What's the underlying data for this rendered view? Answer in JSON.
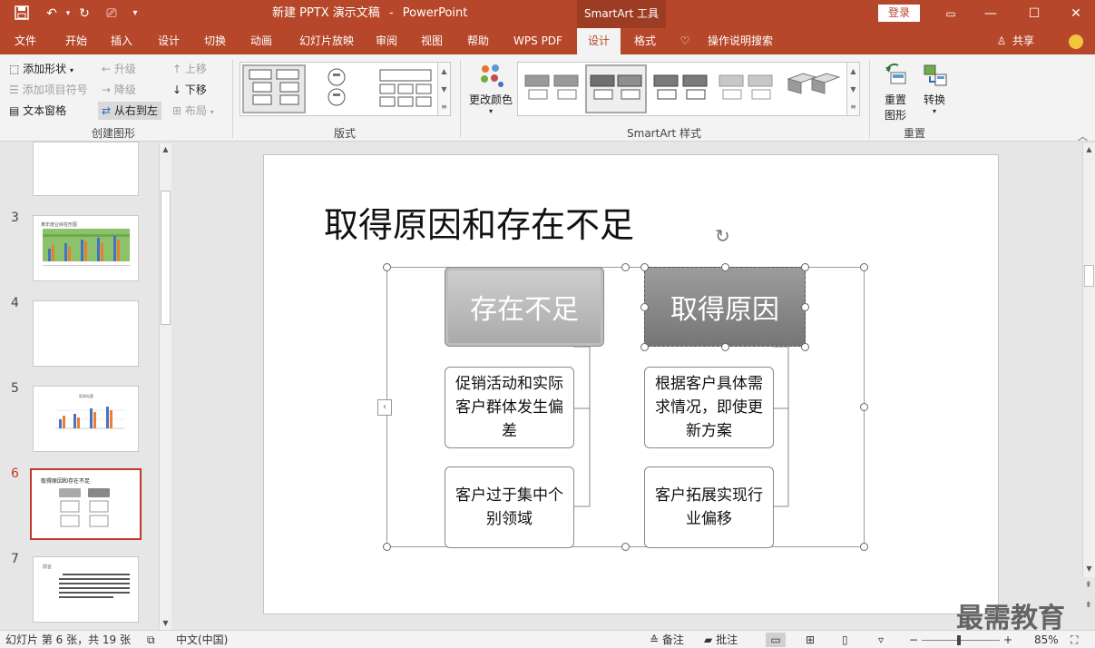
{
  "window": {
    "doc_title": "新建 PPTX 演示文稿",
    "separator": "-",
    "app_name": "PowerPoint",
    "context_tab": "SmartArt 工具",
    "login": "登录"
  },
  "tabs": [
    "文件",
    "开始",
    "插入",
    "设计",
    "切换",
    "动画",
    "幻灯片放映",
    "审阅",
    "视图",
    "帮助",
    "WPS PDF",
    "设计",
    "格式"
  ],
  "tell_me": "操作说明搜索",
  "share": "共享",
  "ribbon": {
    "create": {
      "add_shape": "添加形状",
      "add_bullet": "添加项目符号",
      "text_pane": "文本窗格",
      "promote": "升级",
      "demote": "降级",
      "rtl": "从右到左",
      "move_up": "上移",
      "move_down": "下移",
      "layout": "布局",
      "label": "创建图形"
    },
    "layouts_label": "版式",
    "change_colors": "更改颜色",
    "styles_label": "SmartArt 样式",
    "reset": {
      "reset_graphic_1": "重置",
      "reset_graphic_2": "图形",
      "convert": "转换",
      "label": "重置"
    }
  },
  "thumbnails": [
    {
      "num": "3",
      "caption": "某年度业绩柱形图"
    },
    {
      "num": "4",
      "caption": ""
    },
    {
      "num": "5",
      "caption": "图表标题"
    },
    {
      "num": "6",
      "caption": "取得原因和存在不足"
    },
    {
      "num": "7",
      "caption": "前言"
    }
  ],
  "slide": {
    "title": "取得原因和存在不足",
    "left_head": "存在不足",
    "right_head": "取得原因",
    "left_box1": "促销活动和实际客户群体发生偏差",
    "left_box2": "客户过于集中个别领域",
    "right_box1": "根据客户具体需求情况，即使更新方案",
    "right_box2": "客户拓展实现行业偏移"
  },
  "status": {
    "slide_info": "幻灯片 第 6 张，共 19 张",
    "language": "中文(中国)",
    "notes": "备注",
    "comments": "批注",
    "zoom": "85%"
  },
  "watermark": "最需教育"
}
